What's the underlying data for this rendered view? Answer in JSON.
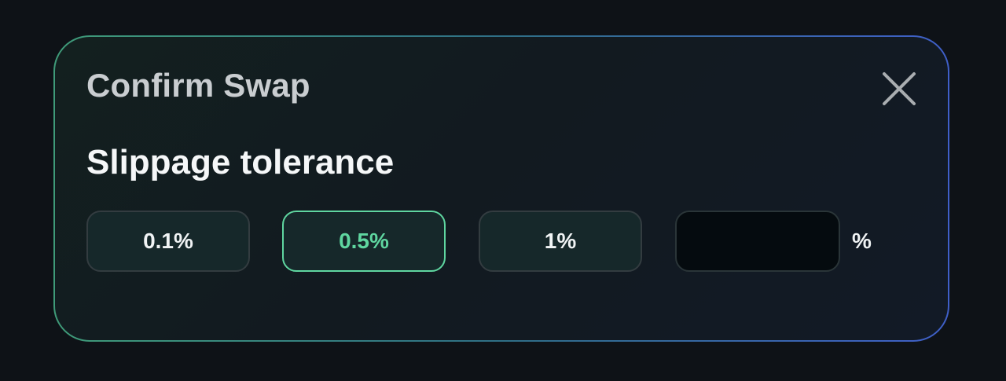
{
  "dialog": {
    "title": "Confirm Swap",
    "close_icon": "close-icon",
    "section_label": "Slippage tolerance"
  },
  "slippage": {
    "options": [
      {
        "label": "0.1%",
        "selected": false
      },
      {
        "label": "0.5%",
        "selected": true
      },
      {
        "label": "1%",
        "selected": false
      }
    ],
    "custom_value": "",
    "custom_placeholder": "",
    "unit": "%"
  },
  "colors": {
    "accent": "#5fd6a0",
    "border_gradient_start": "#3f9b79",
    "border_gradient_end": "#3f5fc8",
    "background": "#0e1217"
  }
}
